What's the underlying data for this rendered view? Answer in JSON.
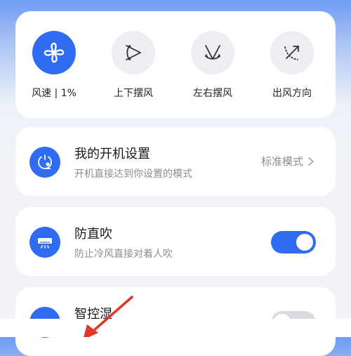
{
  "controls": [
    {
      "label": "风速 | 1%",
      "icon": "fan-icon",
      "active": true
    },
    {
      "label": "上下摆风",
      "icon": "vertical-swing-icon",
      "active": false
    },
    {
      "label": "左右摆风",
      "icon": "horizontal-swing-icon",
      "active": false
    },
    {
      "label": "出风方向",
      "icon": "airflow-direction-icon",
      "active": false
    }
  ],
  "startup_settings": {
    "title": "我的开机设置",
    "subtitle": "开机直接达到你设置的模式",
    "value": "标准模式",
    "icon": "power-user-icon"
  },
  "anti_direct_blow": {
    "title": "防直吹",
    "subtitle": "防止冷风直接对着人吹",
    "enabled": true,
    "icon": "air-conditioner-icon"
  },
  "smart_humidity": {
    "title": "智控湿",
    "enabled": false
  },
  "colors": {
    "accent": "#2f6cf1",
    "arrow": "#e0352b"
  }
}
